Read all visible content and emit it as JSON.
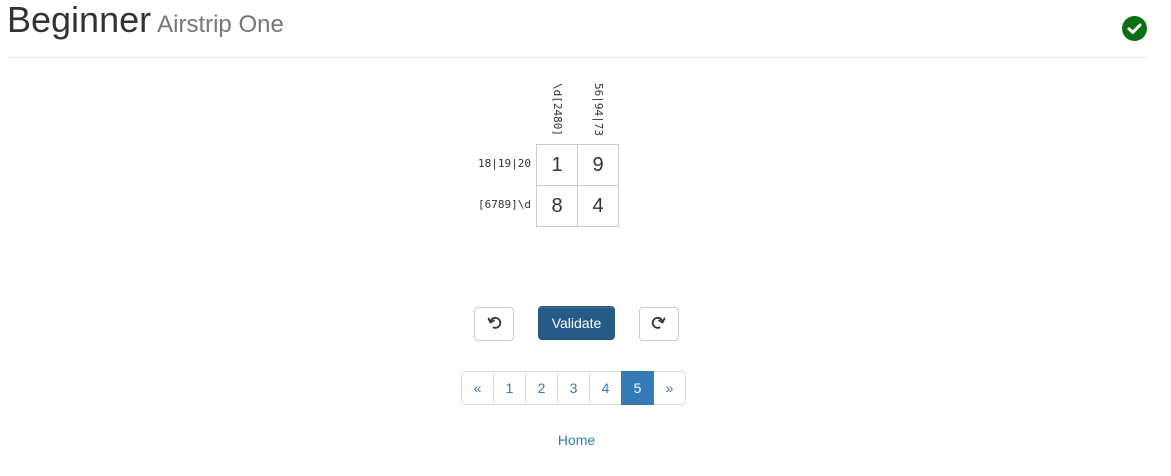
{
  "header": {
    "title": "Beginner",
    "subtitle": "Airstrip One",
    "status_icon": "check-circle-icon",
    "status_color": "#0b6e13"
  },
  "puzzle": {
    "column_clues": [
      "\\d[2480]",
      "56|94|73"
    ],
    "row_clues": [
      "18|19|20",
      "[6789]\\d"
    ],
    "cells": [
      [
        "1",
        "9"
      ],
      [
        "8",
        "4"
      ]
    ]
  },
  "controls": {
    "undo_icon": "undo-icon",
    "validate_label": "Validate",
    "redo_icon": "redo-icon",
    "primary_color": "#265a88"
  },
  "pagination": {
    "prev": "«",
    "pages": [
      "1",
      "2",
      "3",
      "4",
      "5"
    ],
    "next": "»",
    "active_page": "5",
    "active_color": "#337ab7"
  },
  "footer": {
    "home_label": "Home"
  }
}
